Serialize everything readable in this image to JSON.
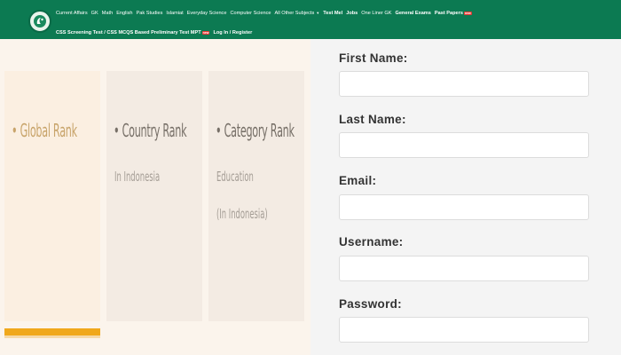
{
  "nav": {
    "row1": [
      {
        "label": "Current Affairs",
        "bold": false
      },
      {
        "label": "GK",
        "bold": false
      },
      {
        "label": "Math",
        "bold": false
      },
      {
        "label": "English",
        "bold": false
      },
      {
        "label": "Pak Studies",
        "bold": false
      },
      {
        "label": "Islamiat",
        "bold": false
      },
      {
        "label": "Everyday Science",
        "bold": false
      },
      {
        "label": "Computer Science",
        "bold": false
      },
      {
        "label": "All Other Subjects",
        "bold": false,
        "dropdown": true
      },
      {
        "label": "Test Mel",
        "bold": true
      },
      {
        "label": "Jobs",
        "bold": true
      },
      {
        "label": "One Liner GK",
        "bold": false
      },
      {
        "label": "General Exams",
        "bold": true
      },
      {
        "label": "Past Papers",
        "bold": true,
        "badge": "new"
      }
    ],
    "row2": [
      {
        "label": "CSS Screening Test / CSS MCQS Based Preliminary Test MPT",
        "bold": true,
        "badge": "new"
      },
      {
        "label": "Log In / Register",
        "bold": true
      }
    ]
  },
  "ranks": {
    "global": {
      "title": "• Global Rank"
    },
    "country": {
      "title": "• Country Rank",
      "sub": "In Indonesia"
    },
    "category": {
      "title": "• Category Rank",
      "sub1": "Education",
      "sub2": "(In Indonesia)"
    }
  },
  "form": {
    "first_name_label": "First Name:",
    "last_name_label": "Last Name:",
    "email_label": "Email:",
    "username_label": "Username:",
    "password_label": "Password:"
  },
  "colors": {
    "nav_bg": "#0c7a52",
    "accent_bar": "#f0a81c",
    "form_bg": "#f4f4f4"
  }
}
